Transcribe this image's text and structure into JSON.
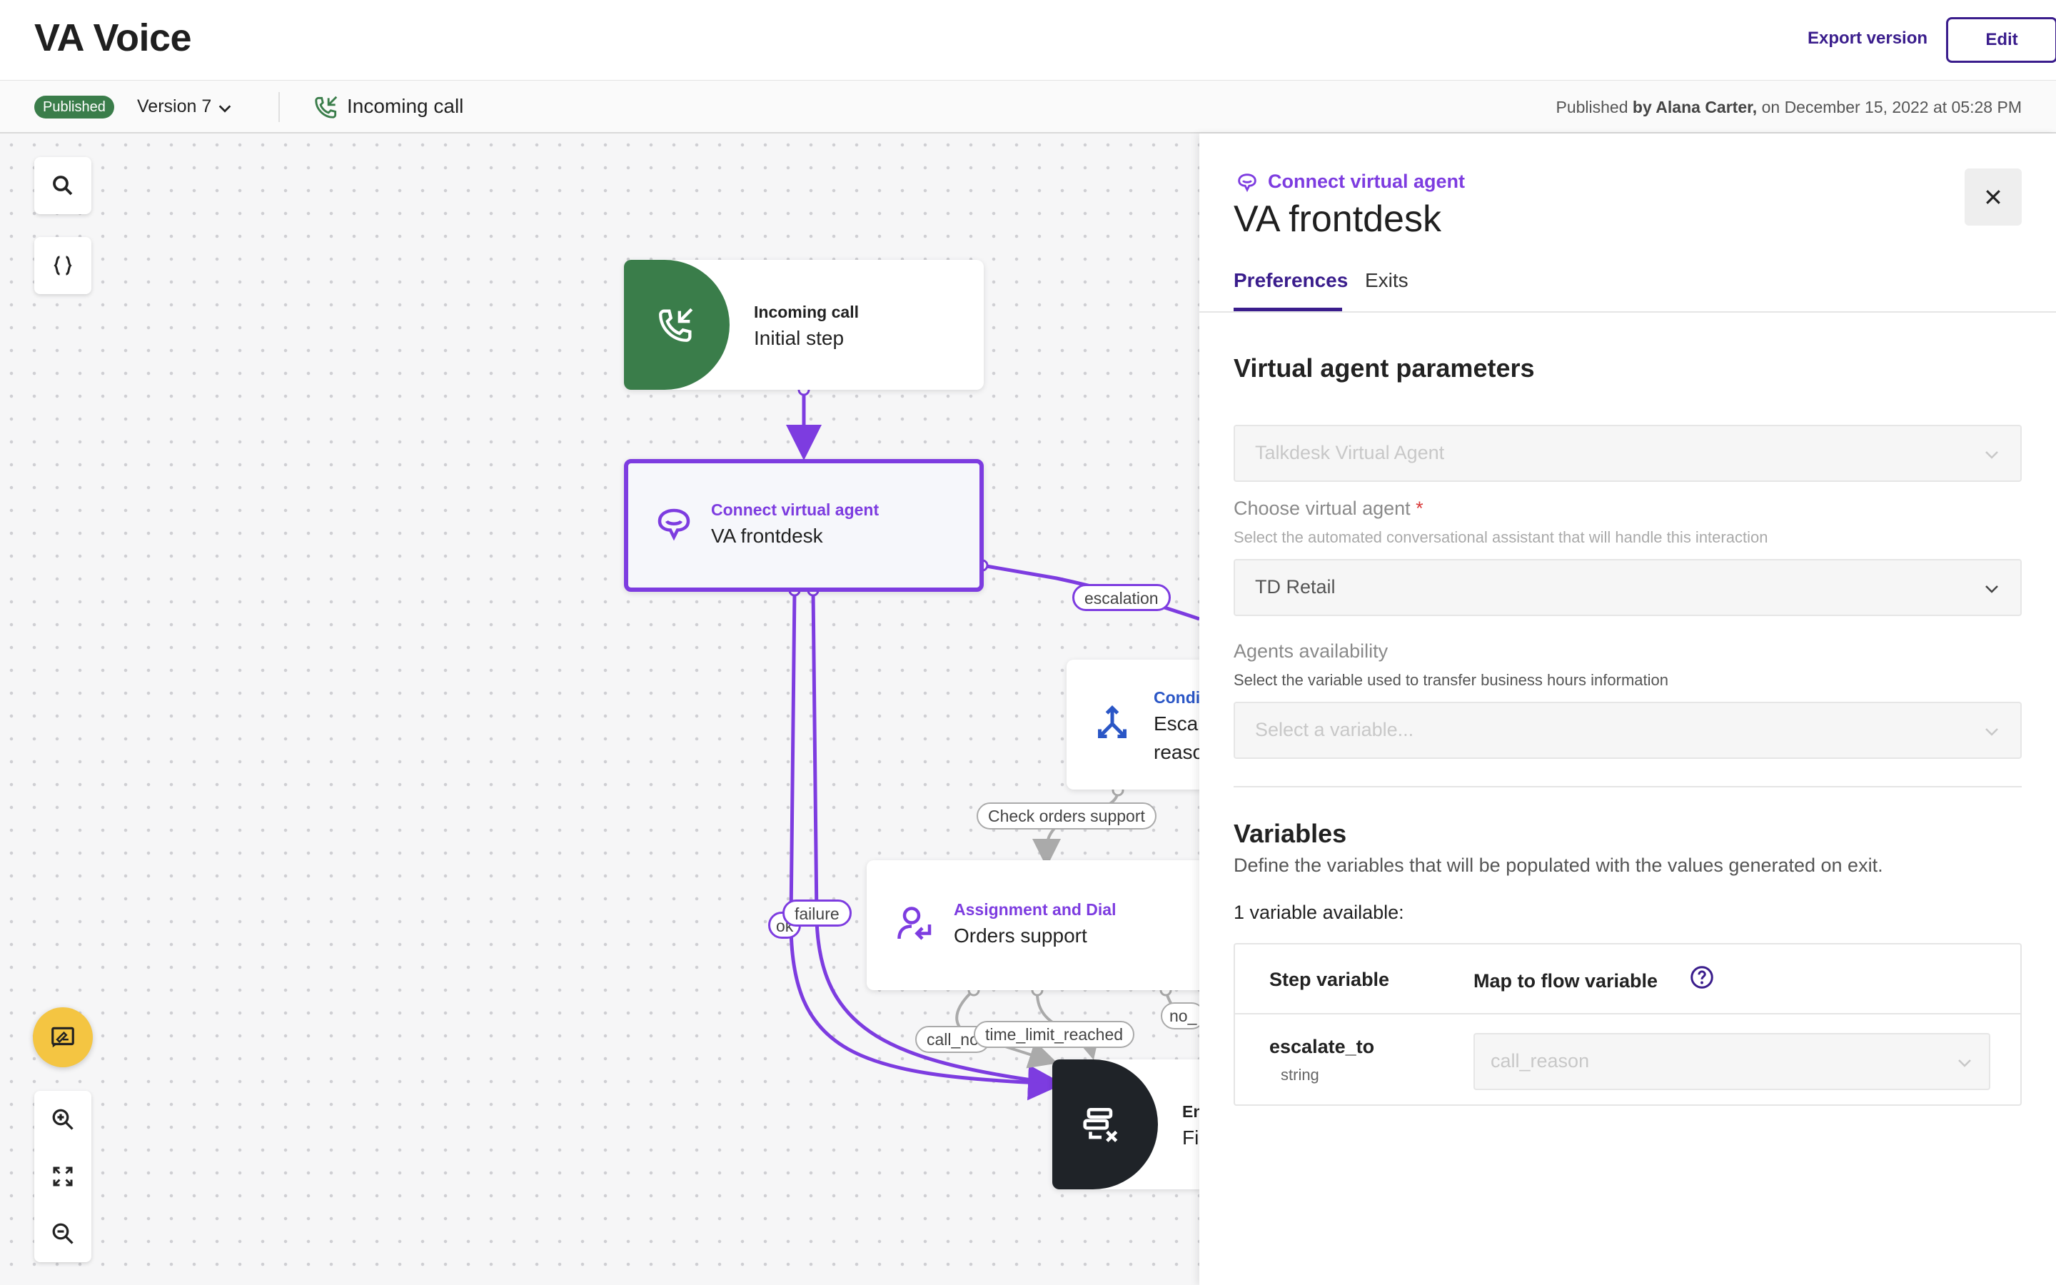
{
  "header": {
    "app_title": "VA Voice",
    "export_label": "Export version",
    "edit_label": "Edit"
  },
  "subbar": {
    "status_badge": "Published",
    "version": "Version 7",
    "trigger": "Incoming call",
    "published_prefix": "Published ",
    "published_by": "by Alana Carter,",
    "published_date": " on December 15, 2022 at 05:28 PM"
  },
  "flow": {
    "nodes": {
      "incoming": {
        "type": "Incoming call",
        "name": "Initial step"
      },
      "va": {
        "type": "Connect virtual agent",
        "name": "VA frontdesk"
      },
      "conditions": {
        "type": "Condi",
        "name1": "Escal",
        "name2": "reaso"
      },
      "assignment": {
        "type": "Assignment and Dial",
        "name": "Orders support"
      },
      "end": {
        "type": "En",
        "name": "Fi"
      }
    },
    "edge_labels": {
      "escalation": "escalation",
      "check_orders": "Check orders support",
      "failure": "failure",
      "ok": "ok",
      "call_no": "call_no",
      "time_limit": "time_limit_reached",
      "no": "no_"
    }
  },
  "panel": {
    "step_type": "Connect virtual agent",
    "title": "VA frontdesk",
    "tabs": [
      "Preferences",
      "Exits"
    ],
    "section_params": "Virtual agent parameters",
    "provider_value": "Talkdesk Virtual Agent",
    "choose_label": "Choose virtual agent",
    "required_mark": "*",
    "choose_help": "Select the automated conversational assistant that will handle this interaction",
    "choose_value": "TD Retail",
    "availability_label": "Agents availability",
    "availability_help": "Select the variable used to transfer business hours information",
    "availability_placeholder": "Select a variable...",
    "section_variables": "Variables",
    "variables_desc": "Define the variables that will be populated with the values generated on exit.",
    "variables_count": "1 variable available:",
    "table": {
      "col_step": "Step variable",
      "col_map": "Map to flow variable",
      "rows": [
        {
          "name": "escalate_to",
          "type": "string",
          "mapped": "call_reason"
        }
      ]
    }
  },
  "colors": {
    "brand": "#3a1d8c",
    "accent": "#7d3ce0",
    "published": "#3a7d4a",
    "condition": "#2a56c6",
    "end_node": "#1f2328"
  },
  "icons": [
    "search-icon",
    "braces-icon",
    "feedback-icon",
    "zoom-in-icon",
    "fit-screen-icon",
    "zoom-out-icon",
    "phone-incoming-icon",
    "chat-bubble-icon",
    "branch-icon",
    "person-transfer-icon",
    "end-flow-icon",
    "close-icon",
    "help-icon",
    "chevron-down-icon"
  ]
}
